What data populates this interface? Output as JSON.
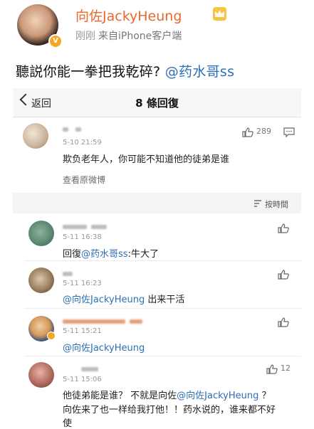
{
  "post": {
    "username": "向佐JackyHeung",
    "time": "刚刚",
    "source": "来自iPhone客户端",
    "text": "聽説你能一拳把我乾碎?",
    "mention": "@药水哥ss"
  },
  "inner": {
    "nav": {
      "back_label": "返回",
      "title": "8 條回復"
    },
    "main_comment": {
      "time": "5-10 21:59",
      "text": "欺负老年人，你可能不知道他的徒弟是谁",
      "link": "查看原微博",
      "likes": "289"
    },
    "sort_label": "按時間",
    "replies": [
      {
        "time": "5-11 16:38",
        "prefix": "回復",
        "mention": "@药水哥ss",
        "text": ":牛大了",
        "likes": ""
      },
      {
        "time": "5-11 16:23",
        "prefix": "",
        "mention": "@向佐JackyHeung",
        "text": " 出来干活",
        "likes": ""
      },
      {
        "time": "5-11 15:21",
        "prefix": "",
        "mention": "@向佐JackyHeung",
        "text": "",
        "likes": ""
      },
      {
        "time": "5-11 15:06",
        "line1_a": "他徒弟能是谁？ 不就是向佐",
        "mention": "@向佐JackyHeung",
        "line1_b": " ？",
        "line2": "向佐来了也一样给我打他！！药水说的，谁来都不好",
        "line3": "使",
        "likes": "12"
      }
    ]
  },
  "colors": {
    "username": "#e9692c",
    "mention": "#2b6fb6",
    "background": "#f4f4f4"
  }
}
